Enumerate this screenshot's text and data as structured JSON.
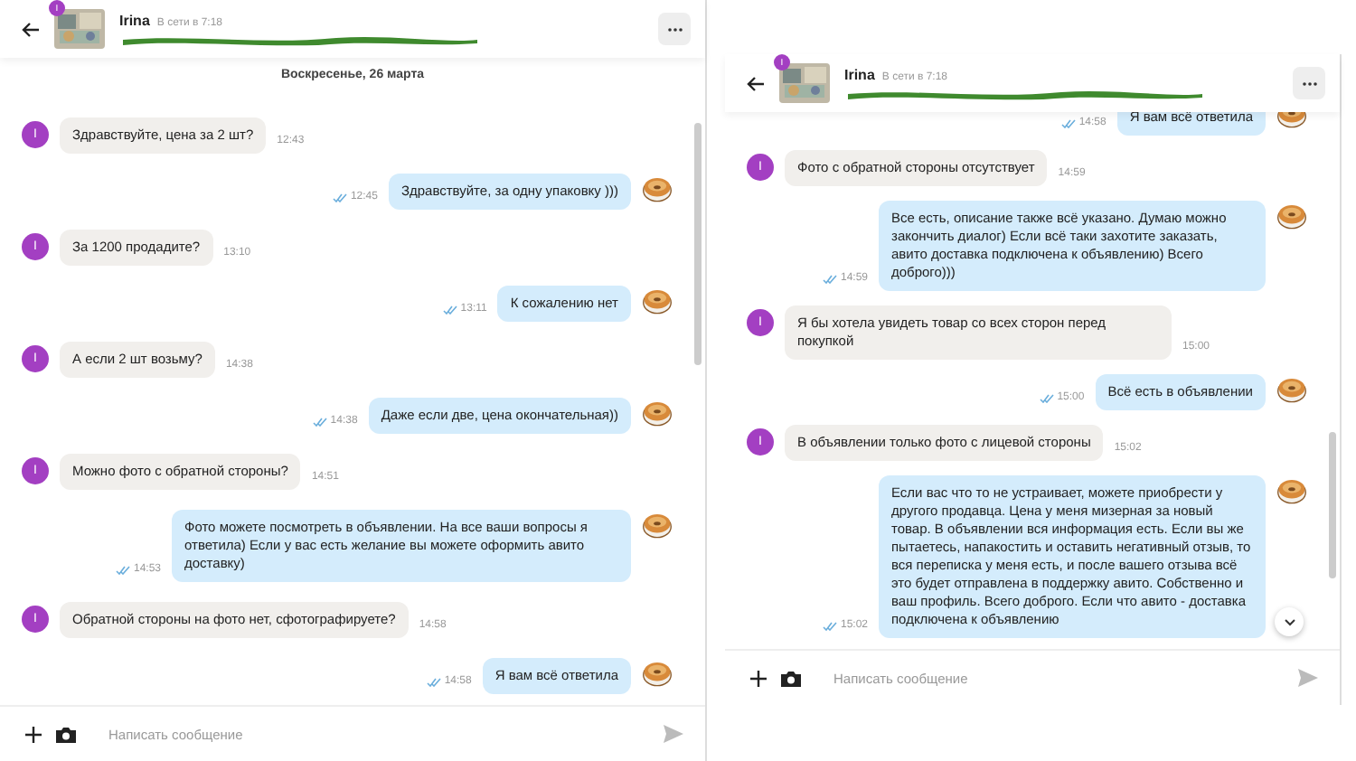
{
  "panels": [
    {
      "header": {
        "name": "Irina",
        "status": "В сети в 7:18",
        "badge": "I"
      },
      "date": "Воскресенье, 26 марта",
      "scroll_down_button": false,
      "messages": [
        {
          "kind": "incoming",
          "avatar_letter": "I",
          "text": "Здравствуйте, цена за 2 шт?",
          "time": "12:43"
        },
        {
          "kind": "outgoing",
          "text": "Здравствуйте, за одну упаковку )))",
          "time": "12:45"
        },
        {
          "kind": "incoming",
          "avatar_letter": "I",
          "text": "За 1200 продадите?",
          "time": "13:10"
        },
        {
          "kind": "outgoing",
          "text": "К сожалению нет",
          "time": "13:11"
        },
        {
          "kind": "incoming",
          "avatar_letter": "I",
          "text": "А если 2 шт возьму?",
          "time": "14:38"
        },
        {
          "kind": "outgoing",
          "text": "Даже если две, цена окончательная))",
          "time": "14:38"
        },
        {
          "kind": "incoming",
          "avatar_letter": "I",
          "text": "Можно фото с обратной стороны?",
          "time": "14:51"
        },
        {
          "kind": "outgoing",
          "text": "Фото можете посмотреть в объявлении. На все ваши вопросы я ответила) Если у вас есть желание вы можете оформить авито доставку)",
          "time": "14:53"
        },
        {
          "kind": "incoming",
          "avatar_letter": "I",
          "text": "Обратной стороны на фото нет, сфотографируете?",
          "time": "14:58"
        },
        {
          "kind": "outgoing",
          "text": "Я вам всё ответила",
          "time": "14:58"
        }
      ],
      "input": {
        "placeholder": "Написать сообщение"
      }
    },
    {
      "header": {
        "name": "Irina",
        "status": "В сети в 7:18",
        "badge": "I"
      },
      "scroll_down_button": true,
      "messages": [
        {
          "kind": "outgoing",
          "text": "Я вам всё ответила",
          "time": "14:58"
        },
        {
          "kind": "incoming",
          "avatar_letter": "I",
          "text": "Фото с обратной стороны отсутствует",
          "time": "14:59"
        },
        {
          "kind": "outgoing",
          "text": "Все есть, описание также всё указано. Думаю можно закончить диалог) Если всё таки захотите заказать, авито доставка подключена к объявлению) Всего доброго)))",
          "time": "14:59"
        },
        {
          "kind": "incoming",
          "avatar_letter": "I",
          "text": "Я бы хотела увидеть товар со всех сторон перед покупкой",
          "time": "15:00"
        },
        {
          "kind": "outgoing",
          "text": "Всё есть в объявлении",
          "time": "15:00"
        },
        {
          "kind": "incoming",
          "avatar_letter": "I",
          "text": "В объявлении только фото с лицевой стороны",
          "time": "15:02"
        },
        {
          "kind": "outgoing",
          "text": "Если вас что то не устраивает, можете приобрести у другого продавца. Цена у меня мизерная за новый товар. В объявлении вся информация есть. Если вы же пытаетесь, напакостить и оставить негативный отзыв, то вся переписка у меня есть, и после вашего отзыва всё это будет отправлена в поддержку авито. Собственно и ваш профиль. Всего доброго. Если что авито - доставка подключена к объявлению",
          "time": "15:02"
        }
      ],
      "input": {
        "placeholder": "Написать сообщение"
      }
    }
  ]
}
